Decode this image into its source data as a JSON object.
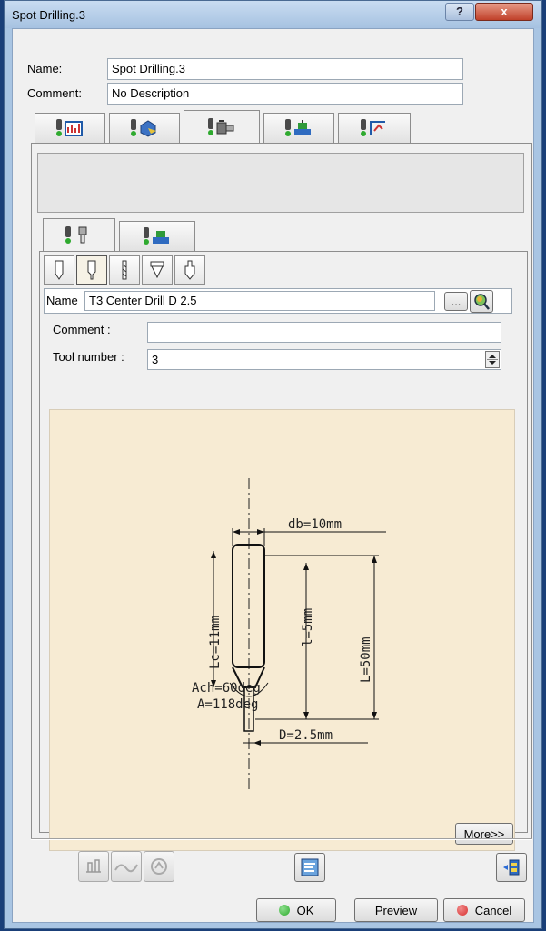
{
  "window": {
    "title": "Spot Drilling.3",
    "help_glyph": "?",
    "close_glyph": "x"
  },
  "form": {
    "name_label": "Name:",
    "name_value": "Spot Drilling.3",
    "comment_label": "Comment:",
    "comment_value": "No Description"
  },
  "main_tabs": [
    {
      "icon": "strategy-icon",
      "active": false
    },
    {
      "icon": "geometry-icon",
      "active": false
    },
    {
      "icon": "tool-assembly-icon",
      "active": true
    },
    {
      "icon": "feeds-speeds-icon",
      "active": false
    },
    {
      "icon": "macros-icon",
      "active": false
    }
  ],
  "sub_tabs": [
    {
      "icon": "tool-icon",
      "active": true
    },
    {
      "icon": "tool-assembly-icon",
      "active": false
    }
  ],
  "tool_types": [
    {
      "icon": "drill-type-1-icon",
      "active": false
    },
    {
      "icon": "center-drill-icon",
      "active": true
    },
    {
      "icon": "twist-drill-icon",
      "active": false
    },
    {
      "icon": "countersink-icon",
      "active": false
    },
    {
      "icon": "step-drill-icon",
      "active": false
    }
  ],
  "tool": {
    "name_label": "Name",
    "name_value": "T3 Center Drill D 2.5",
    "browse_label": "...",
    "comment_label": "Comment :",
    "comment_value": "",
    "tool_number_label": "Tool number :",
    "tool_number_value": "3"
  },
  "drawing": {
    "db": "db=10mm",
    "lc": "Lc=11mm",
    "l_inner": "l=5mm",
    "l_outer": "L=50mm",
    "ach": "Ach=60deg",
    "a": "A=118deg",
    "d": "D=2.5mm"
  },
  "more_label": "More>>",
  "buttons": {
    "ok": "OK",
    "preview": "Preview",
    "cancel": "Cancel"
  },
  "colors": {
    "ok_ball": "#2eaa2e",
    "cancel_ball": "#d83030",
    "drawing_bg": "#f7ebd3"
  }
}
